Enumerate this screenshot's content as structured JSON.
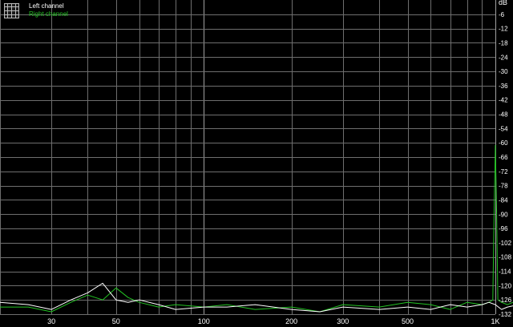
{
  "chart_data": {
    "type": "line",
    "title": "",
    "xlabel": "",
    "ylabel": "dB",
    "x_scale": "log",
    "xlim": [
      20,
      1000
    ],
    "ylim": [
      -132,
      0
    ],
    "grid": true,
    "legend_position": "top-left",
    "x_tick_labels": [
      "30",
      "50",
      "100",
      "200",
      "300",
      "500",
      "1K"
    ],
    "x_tick_values": [
      30,
      50,
      100,
      200,
      300,
      500,
      1000
    ],
    "y_ticks": [
      -6,
      -12,
      -18,
      -24,
      -30,
      -36,
      -42,
      -48,
      -54,
      -60,
      -66,
      -72,
      -78,
      -84,
      -90,
      -96,
      -102,
      -108,
      -114,
      -120,
      -126,
      -132
    ],
    "series": [
      {
        "name": "Left channel",
        "color": "#ffffff",
        "x": [
          20,
          25,
          30,
          35,
          40,
          45,
          50,
          55,
          60,
          70,
          80,
          100,
          120,
          150,
          200,
          250,
          300,
          400,
          500,
          600,
          700,
          800,
          900,
          950,
          1000,
          1050,
          1100,
          1200,
          1400,
          1600,
          2000
        ],
        "y": [
          -127,
          -128,
          -130,
          -126,
          -123,
          -119,
          -126,
          -127,
          -126,
          -128,
          -130,
          -129,
          -129,
          -128,
          -130,
          -131,
          -129,
          -130,
          -129,
          -130,
          -128,
          -129,
          -128,
          -127,
          -128,
          -130,
          -129,
          -128,
          -130,
          -129,
          -129
        ]
      },
      {
        "name": "Right channel",
        "color": "#23c223",
        "x": [
          20,
          25,
          30,
          35,
          40,
          45,
          50,
          55,
          60,
          70,
          80,
          100,
          120,
          150,
          200,
          250,
          300,
          400,
          500,
          600,
          700,
          800,
          900,
          950,
          980,
          990,
          1000,
          1010,
          1020,
          1050,
          1100,
          1200,
          1400,
          1600,
          2000
        ],
        "y": [
          -129,
          -129,
          -131,
          -127,
          -124,
          -126,
          -121,
          -125,
          -127,
          -129,
          -128,
          -129,
          -128,
          -130,
          -129,
          -131,
          -128,
          -129,
          -127,
          -128,
          -130,
          -127,
          -128,
          -127,
          -126,
          -90,
          -61,
          -90,
          -126,
          -127,
          -128,
          -126,
          -128,
          -127,
          -128
        ]
      }
    ]
  },
  "icons": {
    "legend": "grid-icon"
  }
}
